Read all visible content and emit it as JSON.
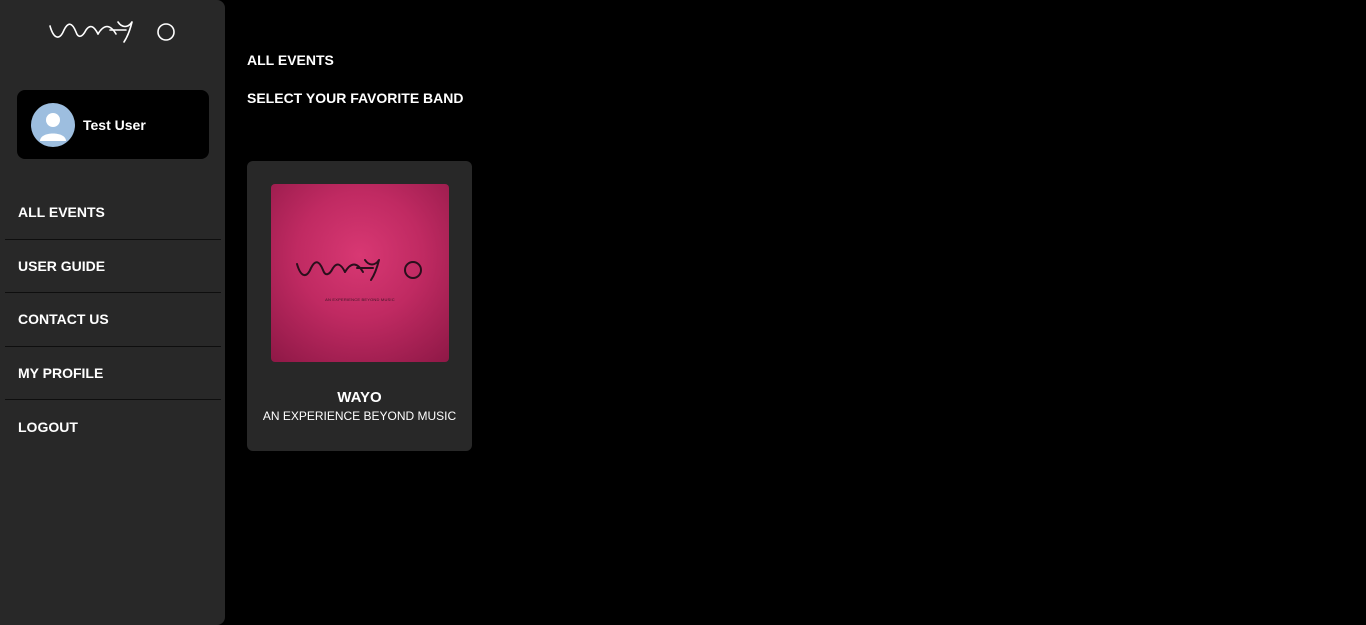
{
  "brand": {
    "logo_text": "WAYO"
  },
  "user": {
    "name": "Test User"
  },
  "sidebar": {
    "items": [
      {
        "label": "ALL EVENTS"
      },
      {
        "label": "USER GUIDE"
      },
      {
        "label": "CONTACT US"
      },
      {
        "label": "MY PROFILE"
      },
      {
        "label": "LOGOUT"
      }
    ]
  },
  "main": {
    "title": "ALL EVENTS",
    "subtitle": "SELECT YOUR FAVORITE BAND",
    "events": [
      {
        "name": "WAYO",
        "tagline": "AN EXPERIENCE BEYOND MUSIC",
        "cover_tagline": "AN EXPERIENCE BEYOND MUSIC",
        "cover_logo_text": "WAYO"
      }
    ]
  },
  "colors": {
    "background": "#000000",
    "sidebar": "#282828",
    "card": "#282828",
    "cover_accent": "#c92b68",
    "avatar": "#9dbedf"
  }
}
